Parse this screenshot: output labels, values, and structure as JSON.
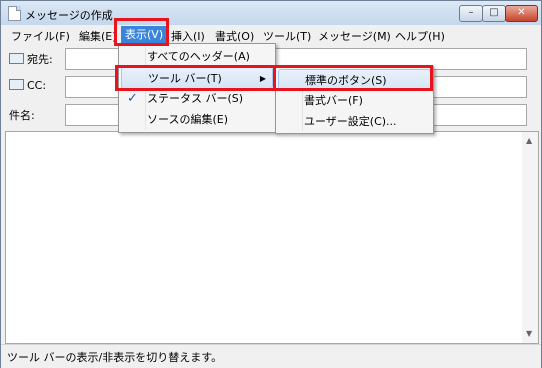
{
  "window": {
    "title": "メッセージの作成",
    "min_label": "–",
    "max_label": "□",
    "close_label": "✕"
  },
  "menubar": {
    "items": [
      "ファイル(F)",
      "編集(E)",
      "表示(V)",
      "挿入(I)",
      "書式(O)",
      "ツール(T)",
      "メッセージ(M)",
      "ヘルプ(H)"
    ]
  },
  "header": {
    "to_label": "宛先:",
    "cc_label": "CC:",
    "subject_label": "件名:"
  },
  "view_menu": {
    "items": [
      "すべてのヘッダー(A)",
      "ツール バー(T)",
      "ステータス バー(S)",
      "ソースの編集(E)"
    ],
    "checked": "ステータス バー(S)"
  },
  "toolbar_submenu": {
    "items": [
      "標準のボタン(S)",
      "書式バー(F)",
      "ユーザー設定(C)..."
    ]
  },
  "status_bar": {
    "text": "ツール バーの表示/非表示を切り替えます。"
  },
  "colors": {
    "highlight_box": "#e8141d",
    "menu_active": "#3a85dc"
  }
}
